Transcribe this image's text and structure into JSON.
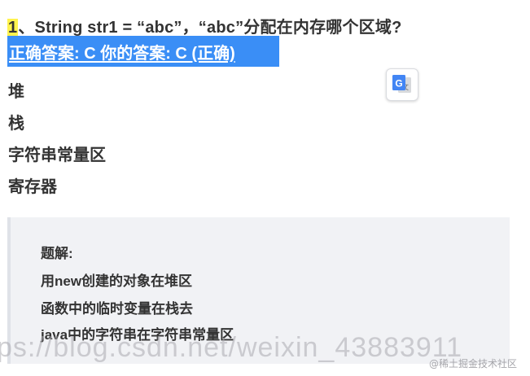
{
  "question": {
    "number": "1",
    "text": "、String str1 = “abc”，“abc”分配在内存哪个区域?"
  },
  "answer": {
    "text": "正确答案: C 你的答案: C (正确)"
  },
  "options": [
    {
      "label": "堆"
    },
    {
      "label": "栈"
    },
    {
      "label": "字符串常量区"
    },
    {
      "label": "寄存器"
    }
  ],
  "translate_button": {
    "icon": "google-translate-icon",
    "colors": {
      "blue": "#4285f4",
      "grey": "#d7d9dc"
    }
  },
  "explanation": {
    "title": "题解:",
    "lines": [
      "用new创建的对象在堆区",
      "函数中的临时变量在栈去",
      "java中的字符串在字符串常量区"
    ]
  },
  "watermarks": {
    "url": "ps://blog.csdn.net/weixin_43883911",
    "juejin": "@稀土掘金技术社区"
  },
  "colors": {
    "answer_bg": "#3a8ef6",
    "highlight": "#fff34d",
    "explain_bg": "#f1f2f5"
  }
}
